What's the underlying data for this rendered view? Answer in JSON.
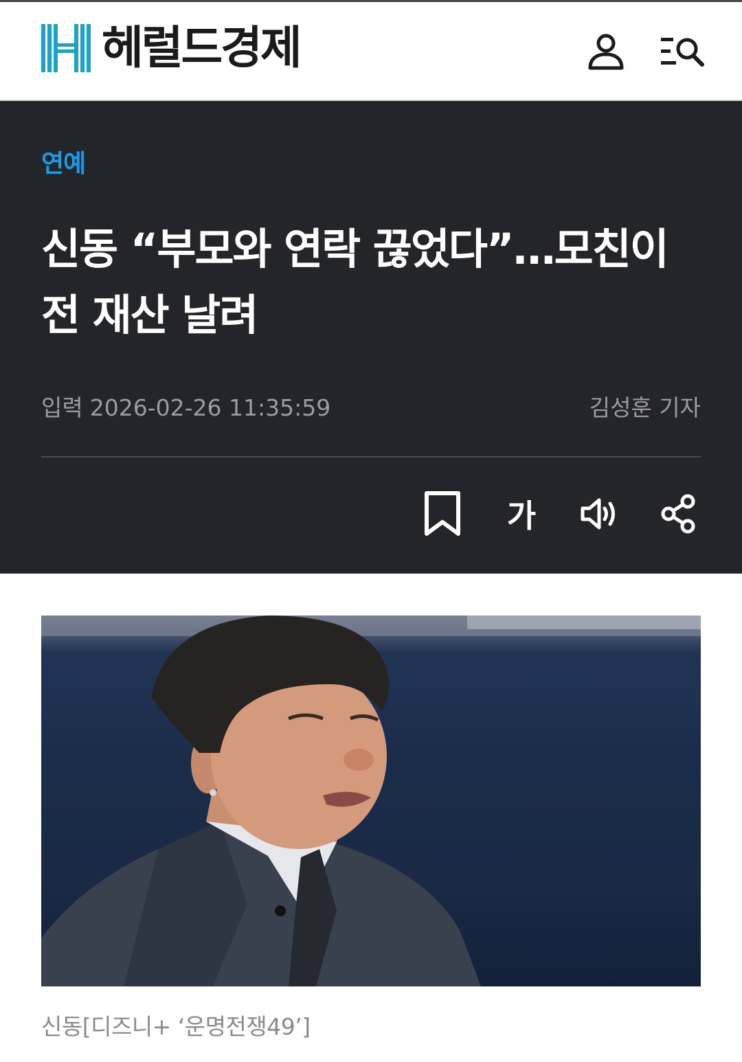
{
  "header": {
    "brand_name": "헤럴드경제",
    "logo_icon": "heraldcorp-h-logo",
    "user_icon": "user-icon",
    "search_menu_icon": "search-menu-icon",
    "brand_color": "#1aa3c8"
  },
  "article": {
    "category": "연예",
    "title": "신동 “부모와 연락 끊었다”…모친이 전 재산 날려",
    "date_label": "입력",
    "date": "2026-02-26 11:35:59",
    "author": "김성훈 기자",
    "tools": {
      "bookmark_icon": "bookmark-icon",
      "font_size_label": "가",
      "audio_icon": "speaker-icon",
      "share_icon": "share-icon"
    },
    "photo_caption": "신동[디즈니+ ‘운명전쟁49’]",
    "accent_color": "#1a9be6",
    "hero_background": "#24252a"
  }
}
